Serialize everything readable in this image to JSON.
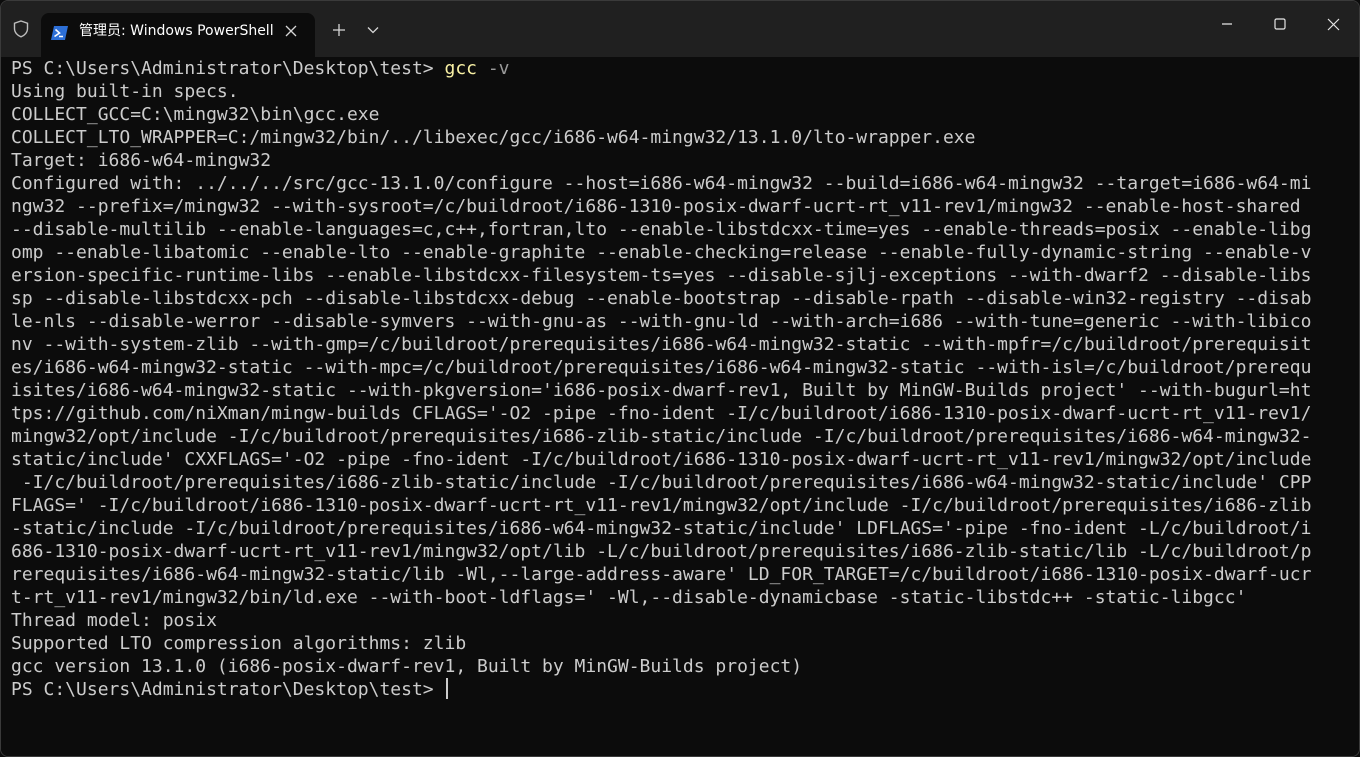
{
  "window": {
    "tab_title": "管理员: Windows PowerShell",
    "icons": {
      "shield": "shield-icon",
      "powershell": "powershell-icon",
      "tab_close": "close-icon",
      "new_tab": "plus-icon",
      "dropdown": "chevron-down-icon",
      "minimize": "minimize-icon",
      "maximize": "maximize-icon",
      "close": "close-icon"
    }
  },
  "terminal": {
    "prompt": "PS C:\\Users\\Administrator\\Desktop\\test> ",
    "command": "gcc",
    "argument": " -v",
    "output_lines": [
      "Using built-in specs.",
      "COLLECT_GCC=C:\\mingw32\\bin\\gcc.exe",
      "COLLECT_LTO_WRAPPER=C:/mingw32/bin/../libexec/gcc/i686-w64-mingw32/13.1.0/lto-wrapper.exe",
      "Target: i686-w64-mingw32",
      "Configured with: ../../../src/gcc-13.1.0/configure --host=i686-w64-mingw32 --build=i686-w64-mingw32 --target=i686-w64-mi",
      "ngw32 --prefix=/mingw32 --with-sysroot=/c/buildroot/i686-1310-posix-dwarf-ucrt-rt_v11-rev1/mingw32 --enable-host-shared",
      "--disable-multilib --enable-languages=c,c++,fortran,lto --enable-libstdcxx-time=yes --enable-threads=posix --enable-libg",
      "omp --enable-libatomic --enable-lto --enable-graphite --enable-checking=release --enable-fully-dynamic-string --enable-v",
      "ersion-specific-runtime-libs --enable-libstdcxx-filesystem-ts=yes --disable-sjlj-exceptions --with-dwarf2 --disable-libs",
      "sp --disable-libstdcxx-pch --disable-libstdcxx-debug --enable-bootstrap --disable-rpath --disable-win32-registry --disab",
      "le-nls --disable-werror --disable-symvers --with-gnu-as --with-gnu-ld --with-arch=i686 --with-tune=generic --with-libico",
      "nv --with-system-zlib --with-gmp=/c/buildroot/prerequisites/i686-w64-mingw32-static --with-mpfr=/c/buildroot/prerequisit",
      "es/i686-w64-mingw32-static --with-mpc=/c/buildroot/prerequisites/i686-w64-mingw32-static --with-isl=/c/buildroot/prerequ",
      "isites/i686-w64-mingw32-static --with-pkgversion='i686-posix-dwarf-rev1, Built by MinGW-Builds project' --with-bugurl=ht",
      "tps://github.com/niXman/mingw-builds CFLAGS='-O2 -pipe -fno-ident -I/c/buildroot/i686-1310-posix-dwarf-ucrt-rt_v11-rev1/",
      "mingw32/opt/include -I/c/buildroot/prerequisites/i686-zlib-static/include -I/c/buildroot/prerequisites/i686-w64-mingw32-",
      "static/include' CXXFLAGS='-O2 -pipe -fno-ident -I/c/buildroot/i686-1310-posix-dwarf-ucrt-rt_v11-rev1/mingw32/opt/include",
      " -I/c/buildroot/prerequisites/i686-zlib-static/include -I/c/buildroot/prerequisites/i686-w64-mingw32-static/include' CPP",
      "FLAGS=' -I/c/buildroot/i686-1310-posix-dwarf-ucrt-rt_v11-rev1/mingw32/opt/include -I/c/buildroot/prerequisites/i686-zlib",
      "-static/include -I/c/buildroot/prerequisites/i686-w64-mingw32-static/include' LDFLAGS='-pipe -fno-ident -L/c/buildroot/i",
      "686-1310-posix-dwarf-ucrt-rt_v11-rev1/mingw32/opt/lib -L/c/buildroot/prerequisites/i686-zlib-static/lib -L/c/buildroot/p",
      "rerequisites/i686-w64-mingw32-static/lib -Wl,--large-address-aware' LD_FOR_TARGET=/c/buildroot/i686-1310-posix-dwarf-ucr",
      "t-rt_v11-rev1/mingw32/bin/ld.exe --with-boot-ldflags=' -Wl,--disable-dynamicbase -static-libstdc++ -static-libgcc'",
      "Thread model: posix",
      "Supported LTO compression algorithms: zlib",
      "gcc version 13.1.0 (i686-posix-dwarf-rev1, Built by MinGW-Builds project)"
    ],
    "final_prompt": "PS C:\\Users\\Administrator\\Desktop\\test> "
  }
}
